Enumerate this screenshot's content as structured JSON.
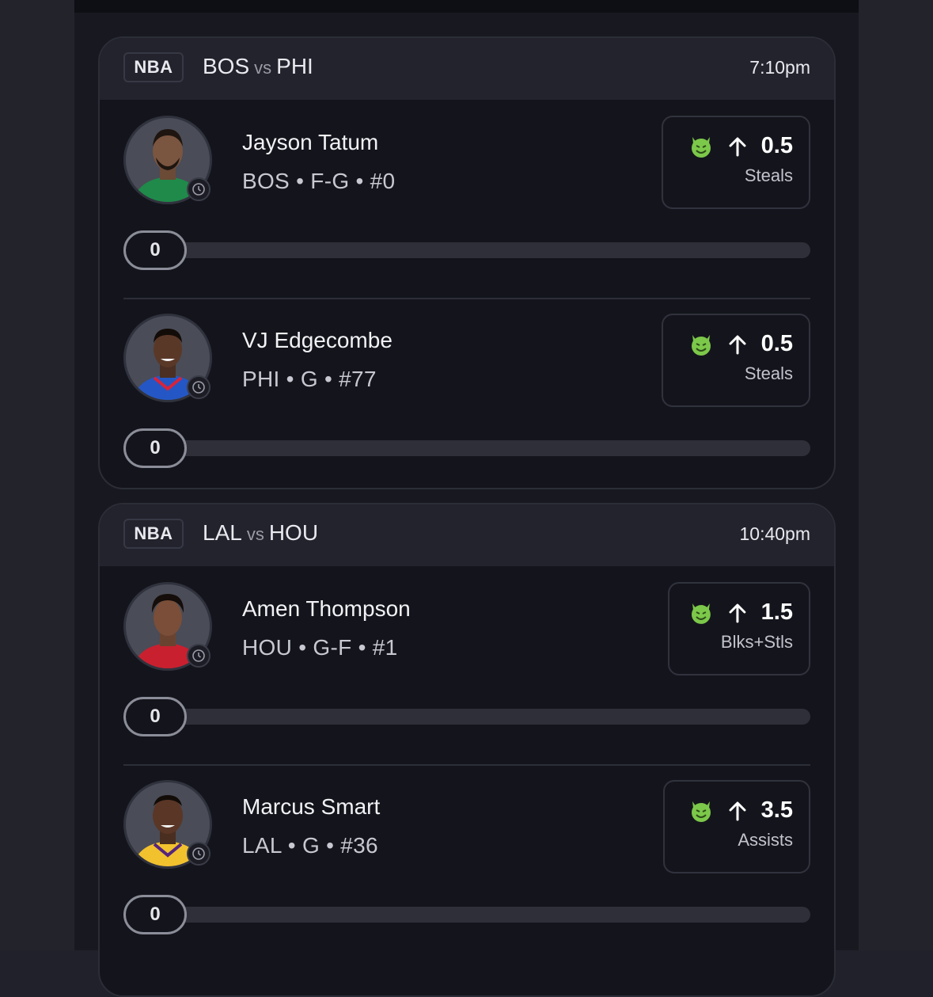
{
  "games": [
    {
      "league": "NBA",
      "away": "BOS",
      "vs": "vs",
      "home": "PHI",
      "time": "7:10pm",
      "players": [
        {
          "name": "Jayson Tatum",
          "meta": "BOS • F-G • #0",
          "line": "0.5",
          "stat": "Steals",
          "progress": "0",
          "jersey": "#1f8a4a"
        },
        {
          "name": "VJ Edgecombe",
          "meta": "PHI • G • #77",
          "line": "0.5",
          "stat": "Steals",
          "progress": "0",
          "jersey": "#2457c5"
        }
      ]
    },
    {
      "league": "NBA",
      "away": "LAL",
      "vs": "vs",
      "home": "HOU",
      "time": "10:40pm",
      "players": [
        {
          "name": "Amen Thompson",
          "meta": "HOU • G-F • #1",
          "line": "1.5",
          "stat": "Blks+Stls",
          "progress": "0",
          "jersey": "#c8202f"
        },
        {
          "name": "Marcus Smart",
          "meta": "LAL • G • #36",
          "line": "3.5",
          "stat": "Assists",
          "progress": "0",
          "jersey": "#f2c12e"
        }
      ]
    }
  ],
  "icons": {
    "pick_icon": "green-devil-icon",
    "direction_icon": "arrow-up-icon",
    "avatar_badge_icon": "clock-icon"
  },
  "colors": {
    "accent_green": "#7cc84a",
    "background": "#181920",
    "card": "#14151c"
  }
}
